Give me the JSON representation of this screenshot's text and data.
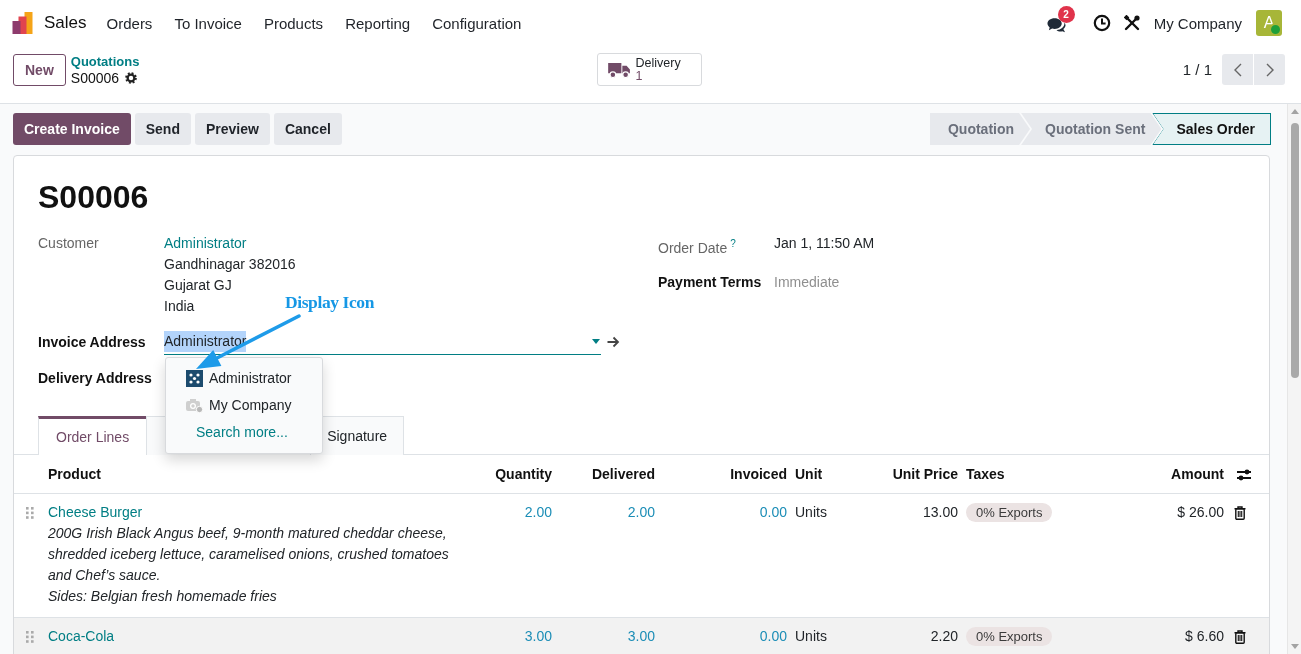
{
  "navbar": {
    "app_name": "Sales",
    "menu": [
      "Orders",
      "To Invoice",
      "Products",
      "Reporting",
      "Configuration"
    ],
    "messages_badge": "2",
    "company": "My Company",
    "avatar": {
      "letter": "A",
      "online": true
    }
  },
  "control_panel": {
    "new_button": "New",
    "breadcrumb": {
      "parent": "Quotations",
      "current": "S00006"
    },
    "smart_button": {
      "label": "Delivery",
      "count": "1"
    },
    "pager": "1 / 1"
  },
  "actions": [
    {
      "label": "Create Invoice",
      "kind": "primary"
    },
    {
      "label": "Send",
      "kind": "secondary"
    },
    {
      "label": "Preview",
      "kind": "secondary"
    },
    {
      "label": "Cancel",
      "kind": "secondary"
    }
  ],
  "statusbar": [
    {
      "label": "Quotation",
      "selected": false
    },
    {
      "label": "Quotation Sent",
      "selected": false
    },
    {
      "label": "Sales Order",
      "selected": true
    }
  ],
  "form": {
    "title": "S00006",
    "customer": {
      "label": "Customer",
      "readonly": true,
      "value": "Administrator",
      "address": [
        "Gandhinagar 382016",
        "Gujarat GJ",
        "India"
      ]
    },
    "invoice_address": {
      "label": "Invoice Address",
      "readonly": false,
      "value": "Administrator",
      "text_selected": true,
      "options": [
        {
          "kind": "avatar",
          "label": "Administrator"
        },
        {
          "kind": "no_image",
          "label": "My Company"
        },
        {
          "kind": "search",
          "label": "Search more..."
        }
      ]
    },
    "delivery_address": {
      "label": "Delivery Address",
      "readonly": false
    },
    "order_date": {
      "label": "Order Date$^{?}$",
      "readonly": true,
      "value": "Jan 1, 11:50 AM"
    },
    "payment_terms": {
      "label": "Payment Terms",
      "readonly": false,
      "placeholder": "Immediate"
    }
  },
  "annotation": {
    "text": "Display Icon"
  },
  "tabs": [
    {
      "label": "Order Lines",
      "selected": true
    },
    {
      "selected": false
    },
    {
      "label": "Signature",
      "selected": false
    }
  ],
  "order_lines": {
    "columns": [
      {
        "label": "Product",
        "kind": "product"
      },
      {
        "label": "Quantity",
        "kind": "info_number"
      },
      {
        "label": "Delivered",
        "kind": "info_number"
      },
      {
        "label": "Invoiced",
        "kind": "info_number"
      },
      {
        "label": "Unit",
        "kind": "text"
      },
      {
        "label": "Unit Price",
        "kind": "number"
      },
      {
        "label": "Taxes",
        "kind": "tags"
      },
      {
        "label": "Amount",
        "kind": "number"
      }
    ],
    "rows": [
      {
        "cells": [
          {
            "name": "Cheese Burger",
            "description": "200G Irish Black Angus beef, 9-month matured cheddar cheese,\nshredded iceberg lettuce, caramelised onions, crushed tomatoes\nand Chef’s sauce.\nSides: Belgian fresh homemade fries"
          },
          "2.00",
          "2.00",
          "0.00",
          "Units",
          "13.00",
          [
            "0% Exports"
          ],
          "$ 26.00"
        ]
      },
      {
        "cells": [
          {
            "name": "Coca-Cola"
          },
          "3.00",
          "3.00",
          "0.00",
          "Units",
          "2.20",
          [
            "0% Exports"
          ],
          "$ 6.60"
        ]
      }
    ]
  }
}
